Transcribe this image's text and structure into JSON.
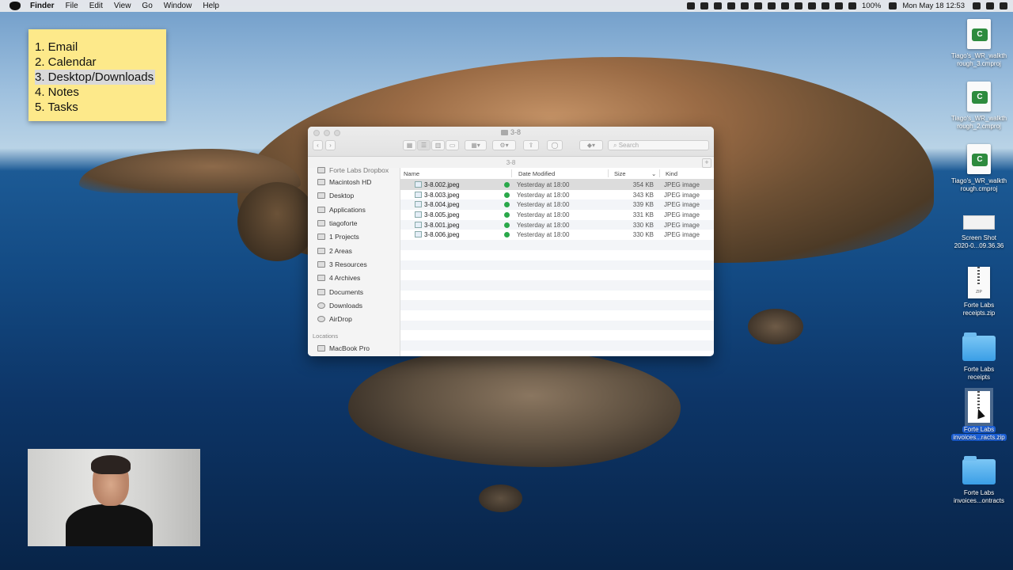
{
  "menubar": {
    "app": "Finder",
    "menus": [
      "File",
      "Edit",
      "View",
      "Go",
      "Window",
      "Help"
    ],
    "battery": "100%",
    "clock": "Mon May 18  12:53"
  },
  "sticky": {
    "lines": [
      "1. Email",
      "2. Calendar",
      "3. Desktop/Downloads",
      "4. Notes",
      "5. Tasks"
    ]
  },
  "finder": {
    "title": "3-8",
    "path": "3-8",
    "search_placeholder": "Search",
    "sidebar": {
      "truncated_top": "Forte Labs Dropbox",
      "items": [
        "Macintosh HD",
        "Desktop",
        "Applications",
        "tiagoforte",
        "1 Projects",
        "2 Areas",
        "3 Resources",
        "4 Archives",
        "Documents",
        "Downloads",
        "AirDrop"
      ],
      "locations_header": "Locations",
      "locations": [
        "MacBook Pro"
      ]
    },
    "columns": {
      "name": "Name",
      "date": "Date Modified",
      "size": "Size",
      "kind": "Kind"
    },
    "files": [
      {
        "name": "3-8.002.jpeg",
        "date": "Yesterday at 18:00",
        "size": "354 KB",
        "kind": "JPEG image"
      },
      {
        "name": "3-8.003.jpeg",
        "date": "Yesterday at 18:00",
        "size": "343 KB",
        "kind": "JPEG image"
      },
      {
        "name": "3-8.004.jpeg",
        "date": "Yesterday at 18:00",
        "size": "339 KB",
        "kind": "JPEG image"
      },
      {
        "name": "3-8.005.jpeg",
        "date": "Yesterday at 18:00",
        "size": "331 KB",
        "kind": "JPEG image"
      },
      {
        "name": "3-8.001.jpeg",
        "date": "Yesterday at 18:00",
        "size": "330 KB",
        "kind": "JPEG image"
      },
      {
        "name": "3-8.006.jpeg",
        "date": "Yesterday at 18:00",
        "size": "330 KB",
        "kind": "JPEG image"
      }
    ]
  },
  "desktop": {
    "icons": [
      {
        "l1": "Tiago's_WR_walkth",
        "l2": "rough_3.cmproj"
      },
      {
        "l1": "Tiago's_WR_walkth",
        "l2": "rough_2.cmproj"
      },
      {
        "l1": "Tiago's_WR_walkth",
        "l2": "rough.cmproj"
      },
      {
        "l1": "Screen Shot",
        "l2": "2020-0...09.36.36"
      },
      {
        "l1": "Forte Labs",
        "l2": "receipts.zip"
      },
      {
        "l1": "Forte Labs",
        "l2": "receipts"
      },
      {
        "l1": "Forte Labs",
        "l2": "invoices...racts.zip"
      },
      {
        "l1": "Forte Labs",
        "l2": "invoices...ontracts"
      }
    ],
    "badge_letter": "C",
    "zip_label": "ZIP"
  }
}
